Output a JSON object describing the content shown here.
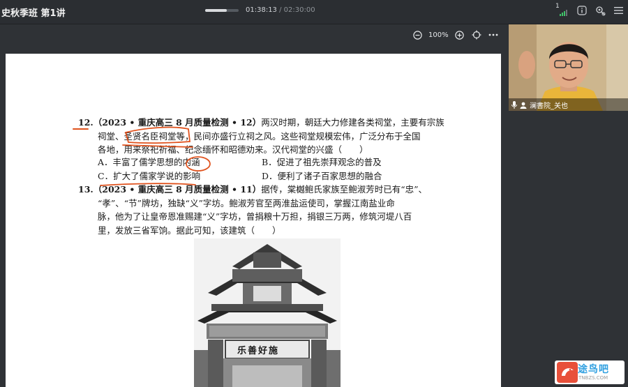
{
  "header": {
    "course_title": "史秋季班 第1讲",
    "time_elapsed": "01:38:13",
    "time_separator": " / ",
    "time_total": "02:30:00",
    "playback_progress": 0.65,
    "online_count": "1"
  },
  "viewer": {
    "zoom_level": "100%"
  },
  "question12": {
    "number": "12.",
    "source": "（2023 • 重庆高三 8 月质量检测 • 12）",
    "line1_rest": "两汉时期，朝廷大力修建各类祠堂，主要有宗族",
    "line2": "祠堂、圣贤名臣祠堂等，民间亦盛行立祠之风。这些祠堂规模宏伟，广泛分布于全国",
    "line3": "各地，用来祭祀祈福、纪念缅怀和昭德劝来。汉代祠堂的兴盛（　　）",
    "options": [
      {
        "label": "A．丰富了儒学思想的内涵"
      },
      {
        "label": "B．促进了祖先崇拜观念的普及"
      },
      {
        "label": "C．扩大了儒家学说的影响"
      },
      {
        "label": "D．便利了诸子百家思想的融合"
      }
    ]
  },
  "question13": {
    "number": "13.",
    "source": "（2023 • 重庆高三 8 月质量检测 • 11）",
    "line1_rest": "据传，棠樾鲍氏家族至鲍淑芳时已有“忠”、",
    "line2": "“孝”、“节”牌坊，独缺“义”字坊。鲍淑芳官至两淮盐运使司，掌握江南盐业命",
    "line3": "脉，他为了让皇帝恩准赐建“义”字坊，曾捐粮十万担，捐银三万两，修筑河堤八百",
    "line4": "里，发放三省军饷。据此可知，该建筑（　　）"
  },
  "photo": {
    "plaque_main": "乐善好施"
  },
  "webcam": {
    "presenter_name": "澜書院_关也"
  },
  "watermark": {
    "brand": "途鸟吧",
    "url": "TNBZS.COM"
  },
  "colors": {
    "annotation_ink": "#e0521d",
    "signal_green": "#3fc46a",
    "watermark_blue": "#2f9fe0"
  }
}
